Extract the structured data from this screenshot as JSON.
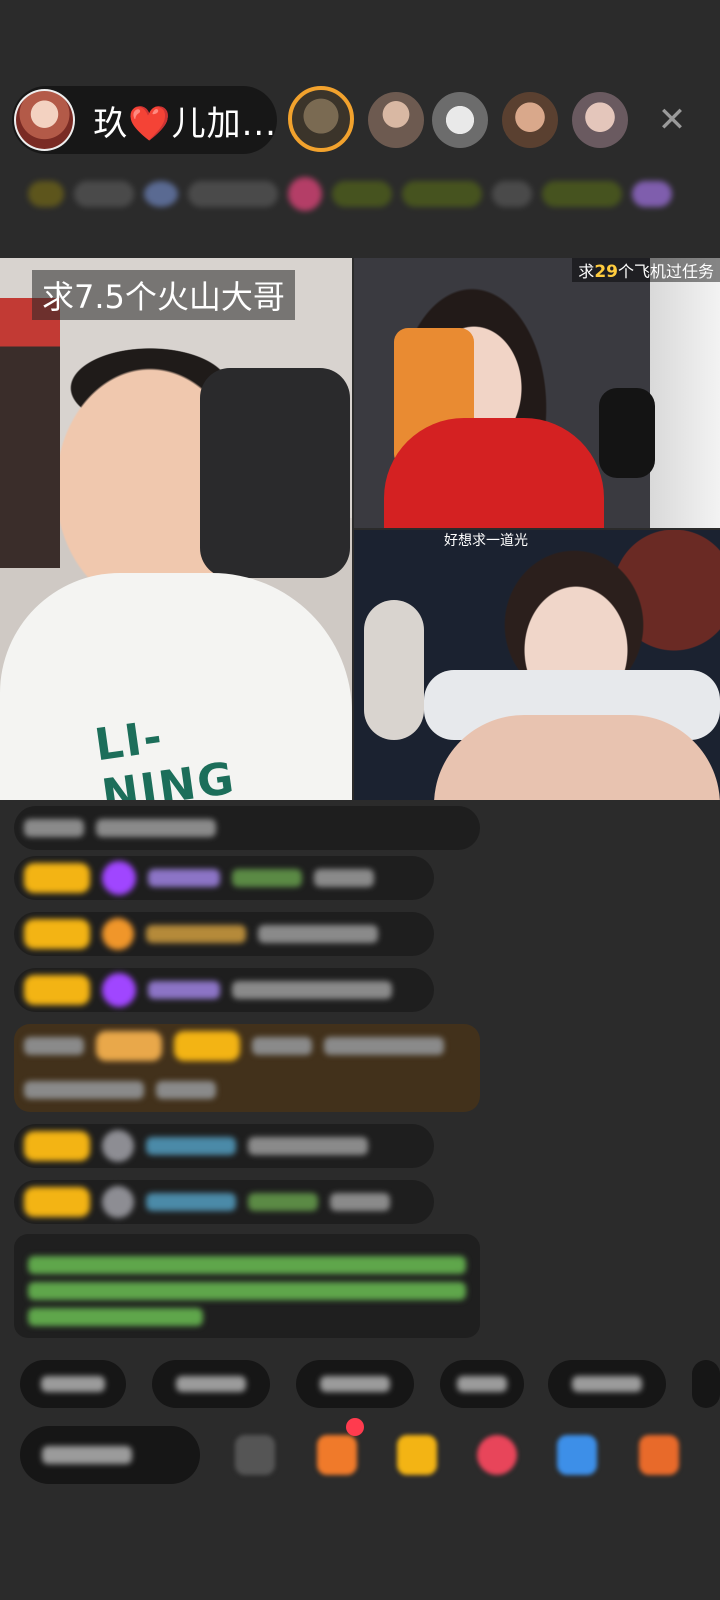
{
  "header": {
    "host_name": "玖❤️儿加...",
    "close_icon": "close-icon",
    "viewer_count": 5
  },
  "video_panels": {
    "main_caption": "求7.5个火山大哥",
    "top_right_caption_prefix": "求",
    "top_right_caption_number": "29",
    "top_right_caption_suffix": "个飞机过任务",
    "bottom_right_caption": "好想求一道光",
    "shirt_text": "LI-NING"
  },
  "colors": {
    "background": "#2b2b2b",
    "badge_yellow": "#f3b414",
    "gift_purple": "#a046ff",
    "notice_green": "#5fa64b",
    "accent_gold": "#ffcc3e"
  },
  "icons": {
    "gift_box": "gift-box-icon",
    "gift_bag": "gift-bag-icon",
    "heart": "heart-icon",
    "share": "share-icon",
    "more": "more-grid-icon",
    "emoji": "emoji-icon"
  }
}
